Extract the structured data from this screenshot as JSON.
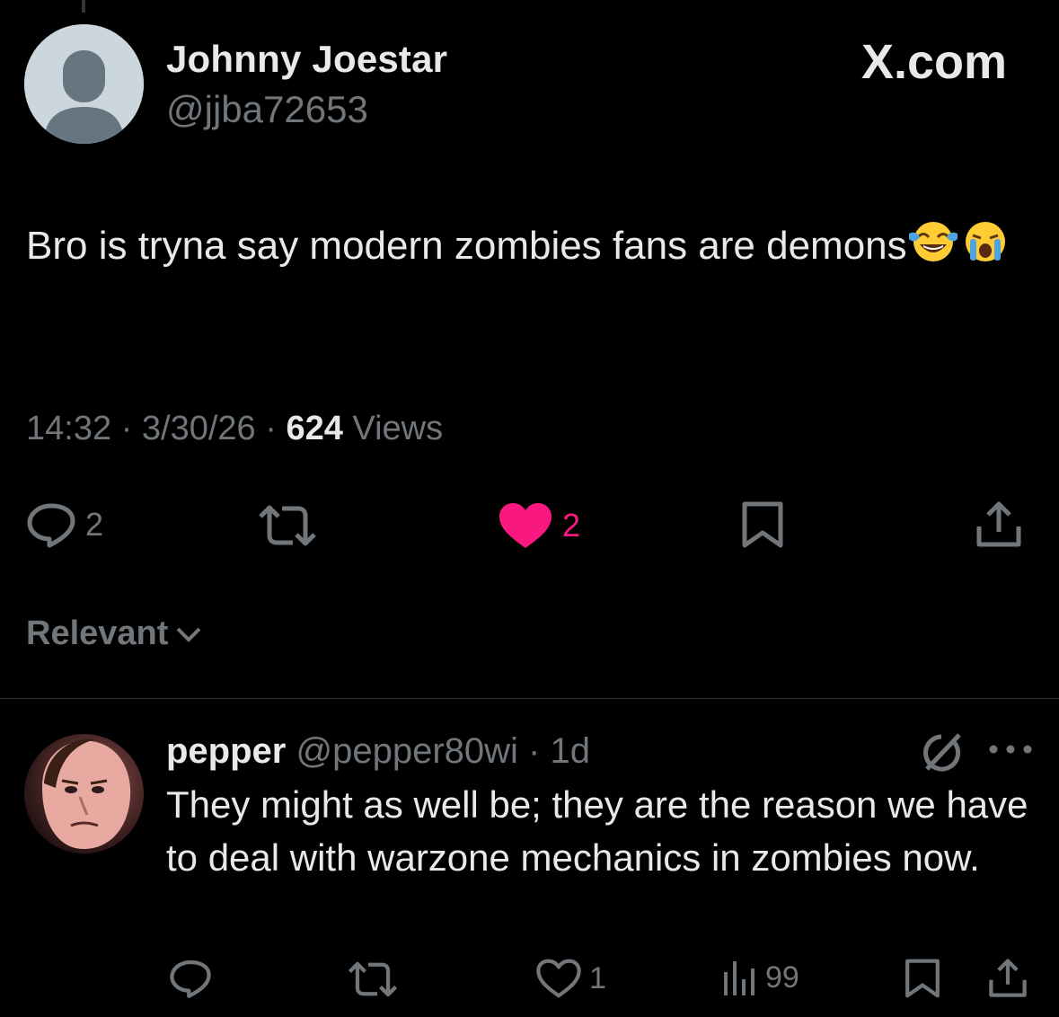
{
  "tweet": {
    "author": {
      "display_name": "Johnny Joestar",
      "handle": "@jjba72653"
    },
    "brand": "X.com",
    "text": "Bro is tryna say modern zombies fans are demons",
    "emojis": [
      "face-with-tears-of-joy",
      "loudly-crying-face"
    ],
    "time": "14:32",
    "date": "3/30/26",
    "views_count": "624",
    "views_label": "Views",
    "actions": {
      "replies": "2",
      "likes": "2"
    },
    "colors": {
      "like_active": "#f91880",
      "muted": "#71767b",
      "text": "#e7e9ea",
      "background": "#000000"
    }
  },
  "sort": {
    "label": "Relevant"
  },
  "reply": {
    "display_name": "pepper",
    "handle": "@pepper80wi",
    "time": "1d",
    "text": "They might as well be; they are the reason we have to deal with warzone mechanics in zombies now.",
    "actions": {
      "likes": "1",
      "views": "99"
    }
  }
}
